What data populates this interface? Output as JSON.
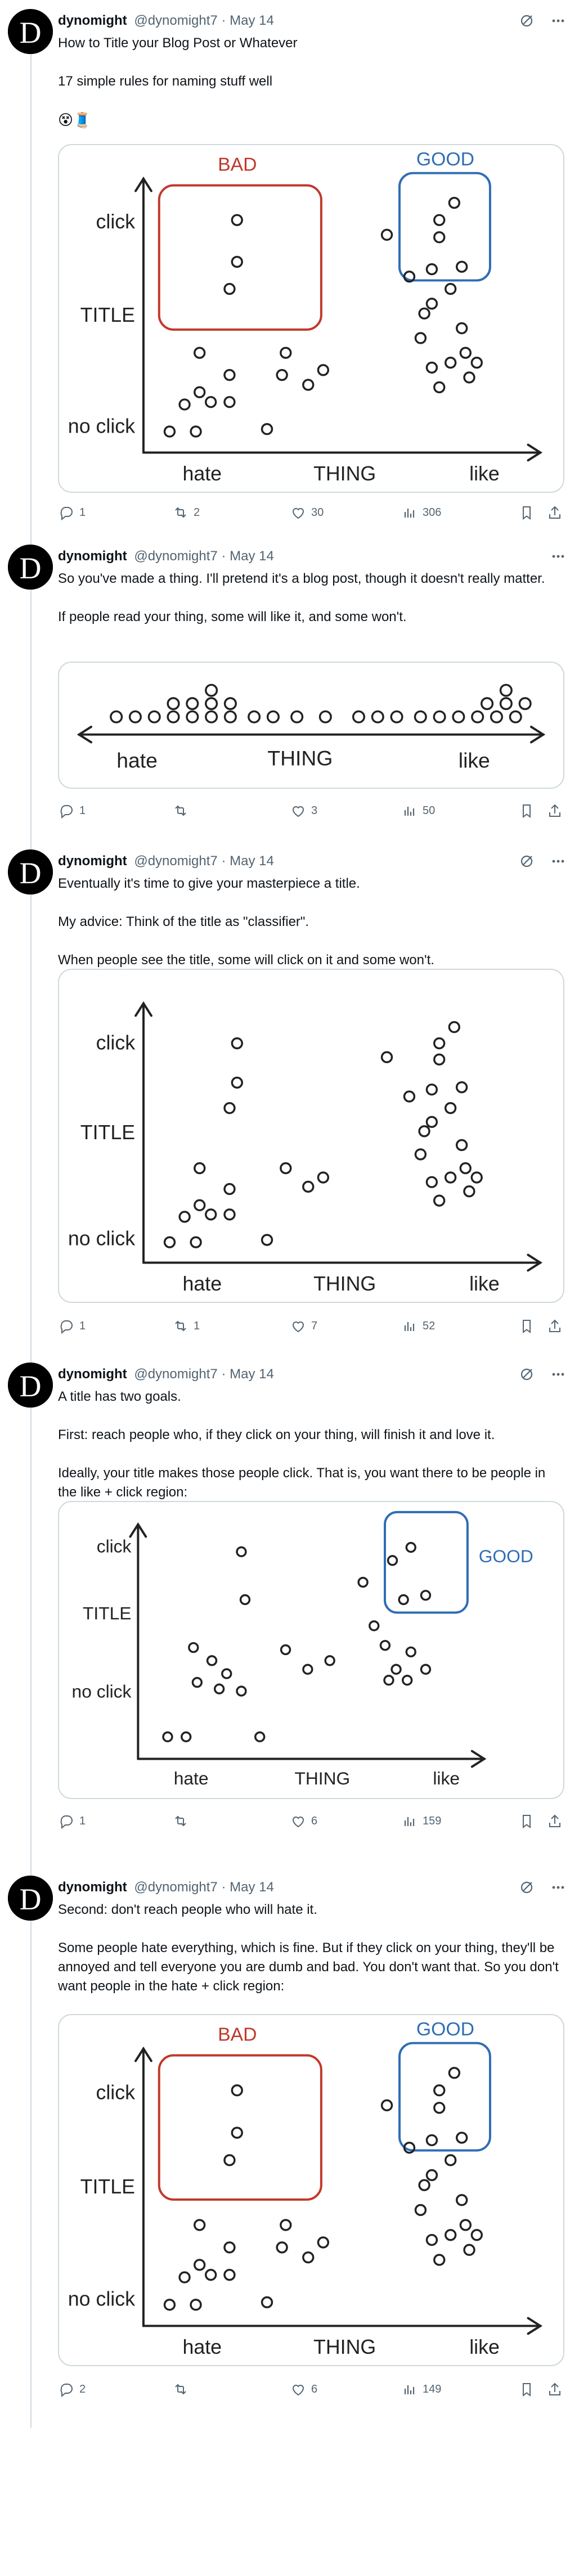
{
  "author": {
    "name": "dynomight",
    "handle": "@dynomight7",
    "date": "May 14",
    "avatar_letter": "D"
  },
  "tweets": [
    {
      "paragraphs": [
        "How to Title your Blog Post or Whatever",
        "17 simple rules for naming stuff well"
      ],
      "emoji": "😵🧵",
      "chart_type": "full-bad-good",
      "stats": {
        "replies": "1",
        "retweets": "2",
        "likes": "30",
        "views": "306"
      }
    },
    {
      "paragraphs": [
        "So you've made a thing. I'll pretend it's a blog post, though it doesn't really matter.",
        "If people read your thing, some will like it, and some won't."
      ],
      "chart_type": "thing-line",
      "stats": {
        "replies": "1",
        "retweets": "",
        "likes": "3",
        "views": "50"
      }
    },
    {
      "paragraphs": [
        "Eventually it's time to give your masterpiece a title.",
        "My advice: Think of the title as \"classifier\".",
        "When people see the title, some will click on it and some won't."
      ],
      "chart_type": "plain",
      "stats": {
        "replies": "1",
        "retweets": "1",
        "likes": "7",
        "views": "52"
      }
    },
    {
      "paragraphs": [
        "A title has two goals.",
        "First: reach people who, if they click on your thing, will finish it and love it.",
        "Ideally, your title makes those people click. That is, you want there to be people in the like + click region:"
      ],
      "chart_type": "good-only",
      "stats": {
        "replies": "1",
        "retweets": "",
        "likes": "6",
        "views": "159"
      }
    },
    {
      "paragraphs": [
        "Second: don't reach people who will hate it.",
        "Some people hate everything, which is fine. But if they click on your thing, they'll be annoyed and tell everyone you are dumb and bad. You don't want that. So you don't want people in the hate + click region:"
      ],
      "chart_type": "full-bad-good",
      "stats": {
        "replies": "2",
        "retweets": "",
        "likes": "6",
        "views": "149"
      }
    }
  ],
  "chart_labels": {
    "y_top": "click",
    "y_mid": "TITLE",
    "y_bottom": "no click",
    "x_left": "hate",
    "x_mid": "THING",
    "x_right": "like",
    "bad_label": "BAD",
    "good_label": "GOOD"
  },
  "colors": {
    "bad": "#c0392b",
    "good": "#2f6db5",
    "ink": "#222222",
    "muted": "#536471",
    "rail": "#cfd9de"
  },
  "chart_data": [
    {
      "type": "scatter",
      "xlabel": "THING",
      "ylabel": "TITLE",
      "x_ticks": [
        "hate",
        "like"
      ],
      "y_ticks": [
        "no click",
        "click"
      ],
      "regions": [
        {
          "name": "BAD",
          "x_range": "hate",
          "y_range": "click"
        },
        {
          "name": "GOOD",
          "x_range": "like",
          "y_range": "click"
        }
      ],
      "points": [
        [
          0.22,
          0.9
        ],
        [
          0.2,
          0.62
        ],
        [
          0.22,
          0.73
        ],
        [
          0.12,
          0.36
        ],
        [
          0.35,
          0.36
        ],
        [
          0.2,
          0.27
        ],
        [
          0.34,
          0.27
        ],
        [
          0.12,
          0.2
        ],
        [
          0.08,
          0.15
        ],
        [
          0.15,
          0.16
        ],
        [
          0.2,
          0.16
        ],
        [
          0.41,
          0.23
        ],
        [
          0.45,
          0.29
        ],
        [
          0.3,
          0.05
        ],
        [
          0.04,
          0.04
        ],
        [
          0.11,
          0.04
        ],
        [
          0.62,
          0.84
        ],
        [
          0.68,
          0.67
        ],
        [
          0.72,
          0.52
        ],
        [
          0.71,
          0.42
        ],
        [
          0.74,
          0.56
        ],
        [
          0.76,
          0.9
        ],
        [
          0.8,
          0.97
        ],
        [
          0.76,
          0.83
        ],
        [
          0.74,
          0.7
        ],
        [
          0.82,
          0.71
        ],
        [
          0.79,
          0.62
        ],
        [
          0.82,
          0.46
        ],
        [
          0.83,
          0.36
        ],
        [
          0.74,
          0.3
        ],
        [
          0.79,
          0.32
        ],
        [
          0.76,
          0.22
        ],
        [
          0.84,
          0.26
        ],
        [
          0.86,
          0.32
        ]
      ]
    },
    {
      "type": "scatter",
      "xlabel": "THING",
      "x_ticks": [
        "hate",
        "like"
      ],
      "points": [
        [
          0.09,
          0
        ],
        [
          0.13,
          0
        ],
        [
          0.17,
          0
        ],
        [
          0.21,
          0
        ],
        [
          0.25,
          0
        ],
        [
          0.29,
          0
        ],
        [
          0.33,
          0
        ],
        [
          0.38,
          0
        ],
        [
          0.42,
          0
        ],
        [
          0.47,
          0
        ],
        [
          0.53,
          0
        ],
        [
          0.6,
          0
        ],
        [
          0.64,
          0
        ],
        [
          0.68,
          0
        ],
        [
          0.73,
          0
        ],
        [
          0.77,
          0
        ],
        [
          0.81,
          0
        ],
        [
          0.85,
          0
        ],
        [
          0.89,
          0
        ],
        [
          0.93,
          0
        ],
        [
          0.21,
          1
        ],
        [
          0.25,
          1
        ],
        [
          0.29,
          1
        ],
        [
          0.33,
          1
        ],
        [
          0.87,
          1
        ],
        [
          0.91,
          1
        ],
        [
          0.95,
          1
        ],
        [
          0.29,
          2
        ],
        [
          0.91,
          2
        ]
      ]
    },
    {
      "type": "scatter",
      "xlabel": "THING",
      "ylabel": "TITLE",
      "x_ticks": [
        "hate",
        "like"
      ],
      "y_ticks": [
        "no click",
        "click"
      ],
      "points": [
        [
          0.22,
          0.9
        ],
        [
          0.2,
          0.62
        ],
        [
          0.22,
          0.73
        ],
        [
          0.12,
          0.36
        ],
        [
          0.2,
          0.27
        ],
        [
          0.12,
          0.2
        ],
        [
          0.08,
          0.15
        ],
        [
          0.15,
          0.16
        ],
        [
          0.2,
          0.16
        ],
        [
          0.3,
          0.05
        ],
        [
          0.04,
          0.04
        ],
        [
          0.11,
          0.04
        ],
        [
          0.35,
          0.36
        ],
        [
          0.41,
          0.28
        ],
        [
          0.45,
          0.32
        ],
        [
          0.62,
          0.84
        ],
        [
          0.68,
          0.67
        ],
        [
          0.72,
          0.52
        ],
        [
          0.71,
          0.42
        ],
        [
          0.74,
          0.56
        ],
        [
          0.76,
          0.9
        ],
        [
          0.8,
          0.97
        ],
        [
          0.76,
          0.83
        ],
        [
          0.74,
          0.7
        ],
        [
          0.82,
          0.71
        ],
        [
          0.79,
          0.62
        ],
        [
          0.82,
          0.46
        ],
        [
          0.83,
          0.36
        ],
        [
          0.74,
          0.3
        ],
        [
          0.79,
          0.32
        ],
        [
          0.76,
          0.22
        ],
        [
          0.84,
          0.26
        ],
        [
          0.86,
          0.32
        ]
      ]
    },
    {
      "type": "scatter",
      "xlabel": "THING",
      "ylabel": "TITLE",
      "x_ticks": [
        "hate",
        "like"
      ],
      "y_ticks": [
        "no click",
        "click"
      ],
      "regions": [
        {
          "name": "GOOD",
          "x_range": "like",
          "y_range": "click"
        }
      ],
      "points": [
        [
          0.25,
          0.9
        ],
        [
          0.26,
          0.68
        ],
        [
          0.12,
          0.46
        ],
        [
          0.17,
          0.4
        ],
        [
          0.13,
          0.3
        ],
        [
          0.21,
          0.34
        ],
        [
          0.19,
          0.27
        ],
        [
          0.25,
          0.26
        ],
        [
          0.3,
          0.05
        ],
        [
          0.05,
          0.05
        ],
        [
          0.1,
          0.05
        ],
        [
          0.37,
          0.45
        ],
        [
          0.43,
          0.36
        ],
        [
          0.49,
          0.4
        ],
        [
          0.58,
          0.76
        ],
        [
          0.66,
          0.86
        ],
        [
          0.71,
          0.92
        ],
        [
          0.69,
          0.68
        ],
        [
          0.75,
          0.7
        ],
        [
          0.61,
          0.56
        ],
        [
          0.64,
          0.47
        ],
        [
          0.71,
          0.44
        ],
        [
          0.75,
          0.36
        ],
        [
          0.67,
          0.36
        ],
        [
          0.7,
          0.31
        ],
        [
          0.65,
          0.31
        ]
      ]
    }
  ]
}
